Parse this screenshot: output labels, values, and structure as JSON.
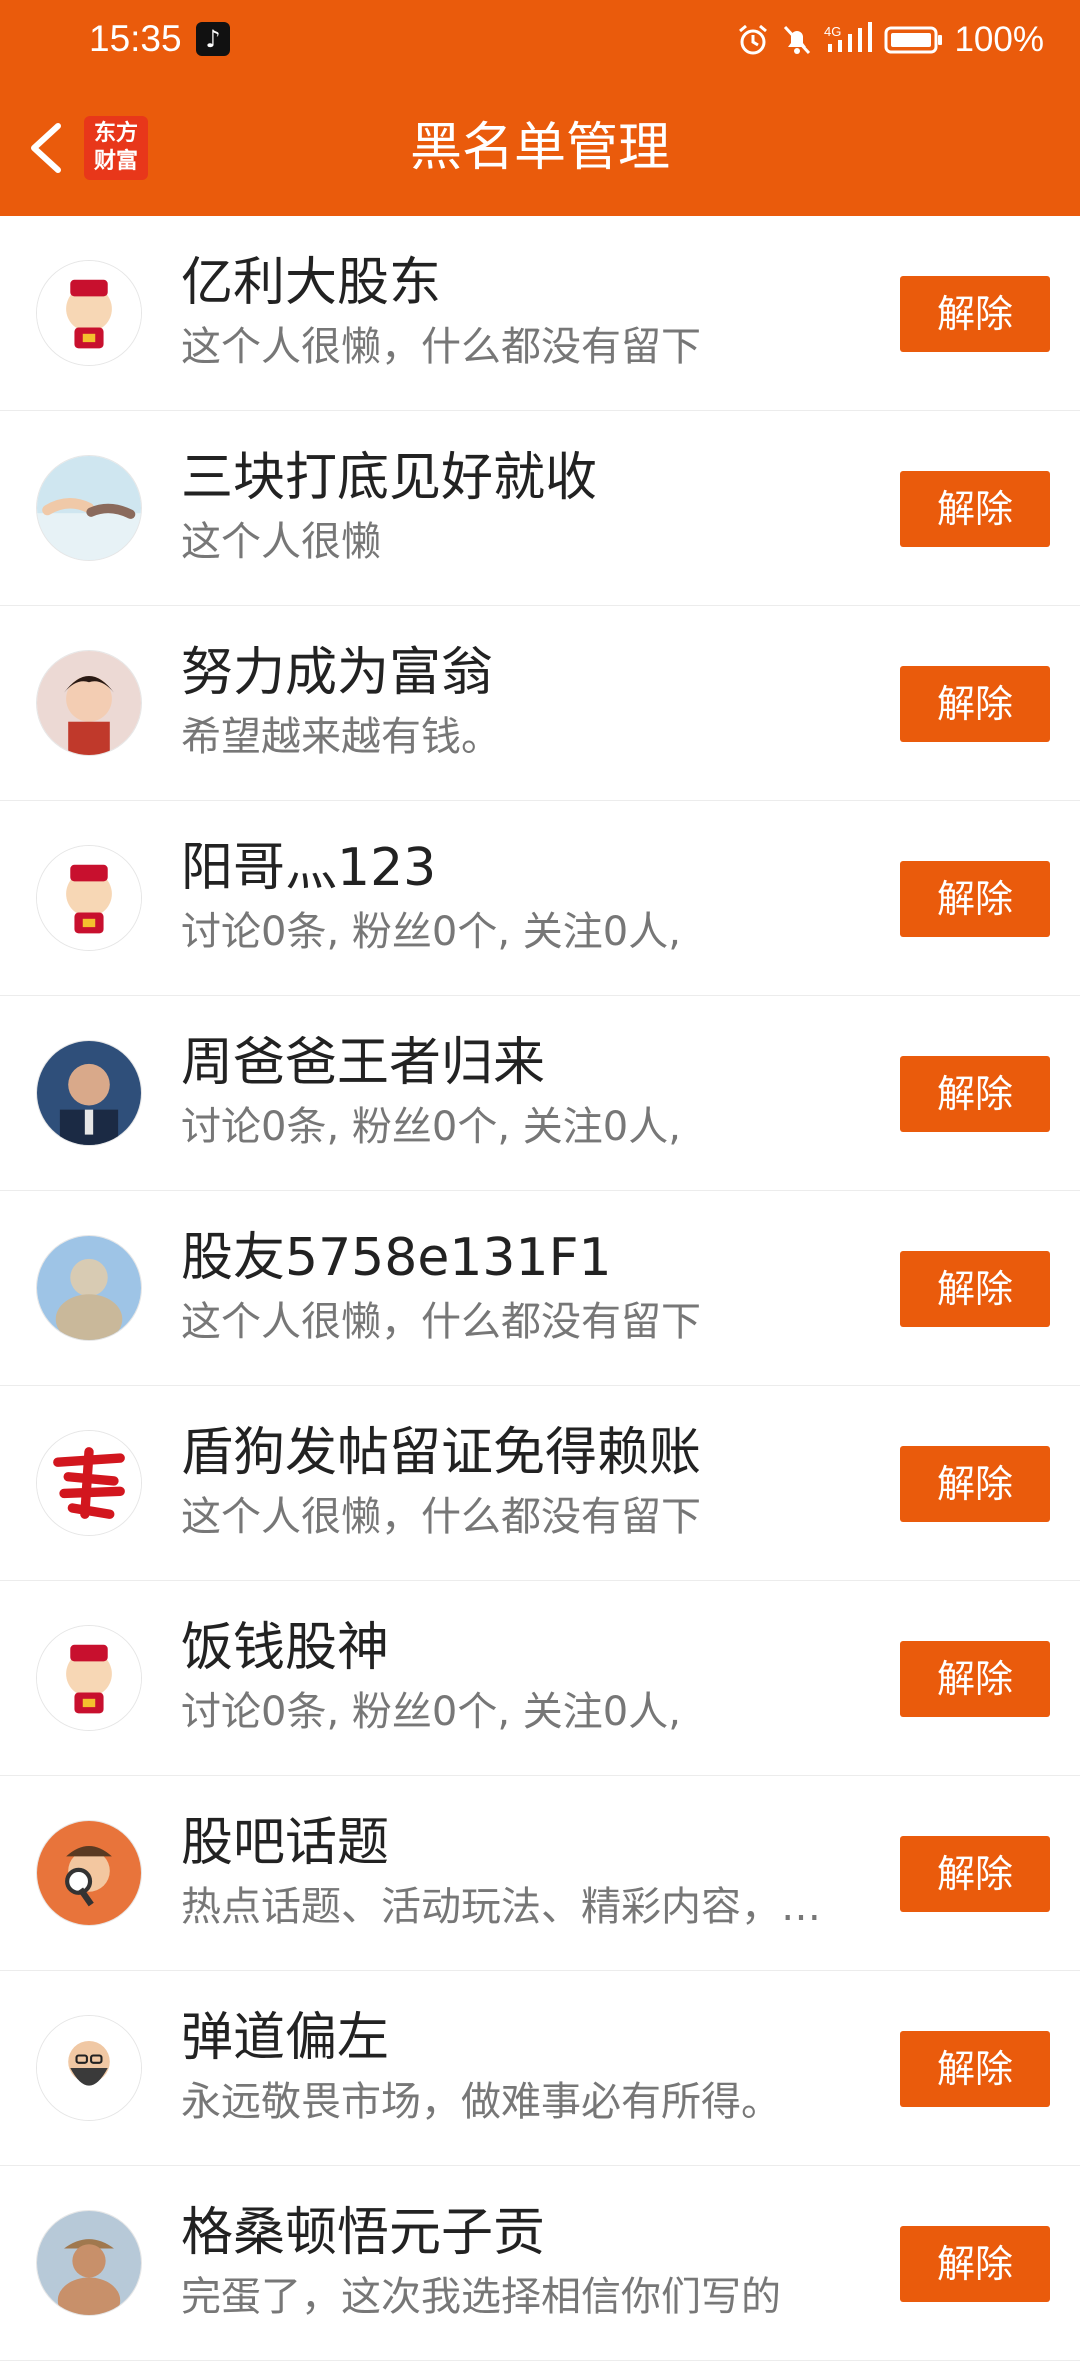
{
  "status_bar": {
    "time": "15:35",
    "battery": "100%"
  },
  "header": {
    "title": "黑名单管理",
    "logo_text": "东方财富",
    "logo_line1": "东方",
    "logo_line2": "财富"
  },
  "colors": {
    "accent": "#ea5b0c"
  },
  "remove_label": "解除",
  "rows": [
    {
      "name": "亿利大股东",
      "desc": "这个人很懒，什么都没有留下",
      "avatar": "caishen-avatar"
    },
    {
      "name": "三块打底见好就收",
      "desc": "这个人很懒",
      "avatar": "hands-avatar"
    },
    {
      "name": "努力成为富翁",
      "desc": "希望越来越有钱。",
      "avatar": "boy-avatar"
    },
    {
      "name": "阳哥灬123",
      "desc": "讨论0条, 粉丝0个, 关注0人,",
      "avatar": "caishen-avatar"
    },
    {
      "name": "周爸爸王者归来",
      "desc": "讨论0条, 粉丝0个, 关注0人,",
      "avatar": "man-avatar"
    },
    {
      "name": "股友5758e131F1",
      "desc": "这个人很懒，什么都没有留下",
      "avatar": "buddha-avatar"
    },
    {
      "name": "盾狗发帖留证免得赖账",
      "desc": "这个人很懒，什么都没有留下",
      "avatar": "fa-character-avatar"
    },
    {
      "name": "饭钱股神",
      "desc": "讨论0条, 粉丝0个, 关注0人,",
      "avatar": "caishen-avatar"
    },
    {
      "name": "股吧话题",
      "desc": "热点话题、活动玩法、精彩内容，…",
      "avatar": "detective-avatar"
    },
    {
      "name": "弹道偏左",
      "desc": "永远敬畏市场，做难事必有所得。",
      "avatar": "bearded-man-avatar"
    },
    {
      "name": "格桑顿悟元子贡",
      "desc": "完蛋了，这次我选择相信你们写的",
      "avatar": "statue-avatar"
    }
  ]
}
